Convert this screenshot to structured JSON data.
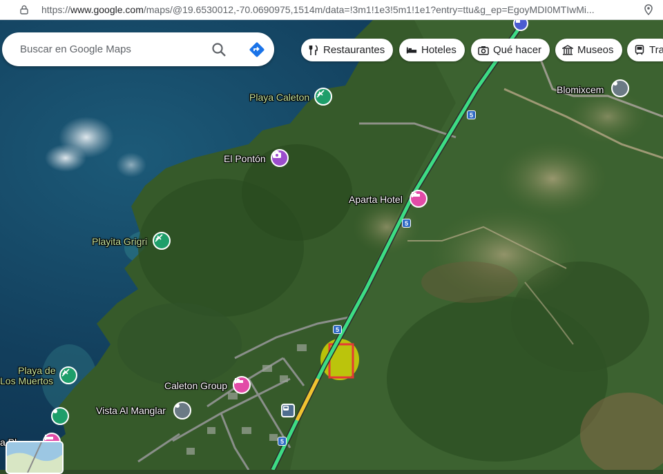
{
  "browser": {
    "url_prefix": "https://",
    "url_domain": "www.google.com",
    "url_rest": "/maps/@19.6530012,-70.0690975,1514m/data=!3m1!1e3!5m1!1e1?entry=ttu&g_ep=EgoyMDI0MTIwMi..."
  },
  "search": {
    "placeholder": "Buscar en Google Maps"
  },
  "chips": [
    {
      "label": "Restaurantes",
      "icon": "fork-knife-icon"
    },
    {
      "label": "Hoteles",
      "icon": "bed-icon"
    },
    {
      "label": "Qué hacer",
      "icon": "camera-icon"
    },
    {
      "label": "Museos",
      "icon": "museum-icon"
    },
    {
      "label": "Tra",
      "icon": "transit-icon"
    }
  ],
  "places": {
    "playa_caleton": "Playa Caleton",
    "el_ponton": "El Pontón",
    "playita_grigri": "Playita Grigri",
    "aparta_hotel": "Aparta Hotel",
    "blomixcem": "Blomixcem",
    "playa_de_los_muertos_1": "Playa de",
    "playa_de_los_muertos_2": "Los Muertos",
    "caleton_group": "Caleton Group",
    "vista_al_manglar": "Vista Al Manglar",
    "partial_label": "a Pl"
  },
  "highway": {
    "route_number": "5"
  },
  "colors": {
    "beach_pin": "#1e9e6a",
    "hotel_pin": "#e24ba7",
    "attraction_pin": "#9c4dcc",
    "gray_pin": "#6b7a85",
    "highway_traffic": "#3ddc84",
    "highlight_area": "#e6e600",
    "selection_box": "#e53935"
  }
}
